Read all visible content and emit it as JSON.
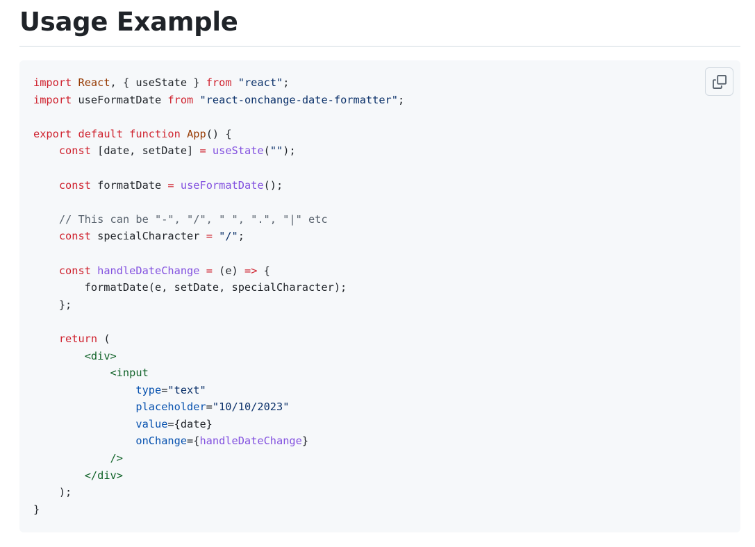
{
  "page": {
    "heading": "Usage Example"
  },
  "copy_button": {
    "icon": "copy-icon",
    "border_color": "#d1d9e0"
  },
  "colors": {
    "keyword": "#cf222e",
    "function": "#8250df",
    "string": "#0a3069",
    "comment": "#59636e",
    "tag": "#116329",
    "attribute": "#0550ae",
    "entity": "#953800",
    "plain": "#1f2328",
    "code_background": "#f6f8fa"
  },
  "code": {
    "language": "jsx",
    "lines": [
      [
        [
          "kw",
          "import"
        ],
        [
          "pl",
          " "
        ],
        [
          "ent",
          "React"
        ],
        [
          "pl",
          ", { useState } "
        ],
        [
          "kw",
          "from"
        ],
        [
          "pl",
          " "
        ],
        [
          "str",
          "\"react\""
        ],
        [
          "pl",
          ";"
        ]
      ],
      [
        [
          "kw",
          "import"
        ],
        [
          "pl",
          " useFormatDate "
        ],
        [
          "kw",
          "from"
        ],
        [
          "pl",
          " "
        ],
        [
          "str",
          "\"react-onchange-date-formatter\""
        ],
        [
          "pl",
          ";"
        ]
      ],
      [],
      [
        [
          "kw",
          "export"
        ],
        [
          "pl",
          " "
        ],
        [
          "kw",
          "default"
        ],
        [
          "pl",
          " "
        ],
        [
          "kw",
          "function"
        ],
        [
          "pl",
          " "
        ],
        [
          "ent",
          "App"
        ],
        [
          "pl",
          "() {"
        ]
      ],
      [
        [
          "pl",
          "    "
        ],
        [
          "kw",
          "const"
        ],
        [
          "pl",
          " [date, setDate] "
        ],
        [
          "kw",
          "="
        ],
        [
          "pl",
          " "
        ],
        [
          "fn",
          "useState"
        ],
        [
          "pl",
          "("
        ],
        [
          "str",
          "\"\""
        ],
        [
          "pl",
          ");"
        ]
      ],
      [],
      [
        [
          "pl",
          "    "
        ],
        [
          "kw",
          "const"
        ],
        [
          "pl",
          " formatDate "
        ],
        [
          "kw",
          "="
        ],
        [
          "pl",
          " "
        ],
        [
          "fn",
          "useFormatDate"
        ],
        [
          "pl",
          "();"
        ]
      ],
      [],
      [
        [
          "pl",
          "    "
        ],
        [
          "com",
          "// This can be \"-\", \"/\", \" \", \".\", \"|\" etc"
        ]
      ],
      [
        [
          "pl",
          "    "
        ],
        [
          "kw",
          "const"
        ],
        [
          "pl",
          " specialCharacter "
        ],
        [
          "kw",
          "="
        ],
        [
          "pl",
          " "
        ],
        [
          "str",
          "\"/\""
        ],
        [
          "pl",
          ";"
        ]
      ],
      [],
      [
        [
          "pl",
          "    "
        ],
        [
          "kw",
          "const"
        ],
        [
          "pl",
          " "
        ],
        [
          "fn",
          "handleDateChange"
        ],
        [
          "pl",
          " "
        ],
        [
          "kw",
          "="
        ],
        [
          "pl",
          " (e) "
        ],
        [
          "kw",
          "=>"
        ],
        [
          "pl",
          " {"
        ]
      ],
      [
        [
          "pl",
          "        formatDate(e, setDate, specialCharacter);"
        ]
      ],
      [
        [
          "pl",
          "    };"
        ]
      ],
      [],
      [
        [
          "pl",
          "    "
        ],
        [
          "kw",
          "return"
        ],
        [
          "pl",
          " ("
        ]
      ],
      [
        [
          "pl",
          "        "
        ],
        [
          "tag",
          "<div>"
        ]
      ],
      [
        [
          "pl",
          "            "
        ],
        [
          "tag",
          "<input"
        ]
      ],
      [
        [
          "pl",
          "                "
        ],
        [
          "attr",
          "type"
        ],
        [
          "pl",
          "="
        ],
        [
          "str",
          "\"text\""
        ]
      ],
      [
        [
          "pl",
          "                "
        ],
        [
          "attr",
          "placeholder"
        ],
        [
          "pl",
          "="
        ],
        [
          "str",
          "\"10/10/2023\""
        ]
      ],
      [
        [
          "pl",
          "                "
        ],
        [
          "attr",
          "value"
        ],
        [
          "pl",
          "={date}"
        ]
      ],
      [
        [
          "pl",
          "                "
        ],
        [
          "attr",
          "onChange"
        ],
        [
          "pl",
          "={"
        ],
        [
          "fn",
          "handleDateChange"
        ],
        [
          "pl",
          "}"
        ]
      ],
      [
        [
          "pl",
          "            "
        ],
        [
          "tag",
          "/>"
        ]
      ],
      [
        [
          "pl",
          "        "
        ],
        [
          "tag",
          "</div>"
        ]
      ],
      [
        [
          "pl",
          "    );"
        ]
      ],
      [
        [
          "pl",
          "}"
        ]
      ]
    ]
  }
}
